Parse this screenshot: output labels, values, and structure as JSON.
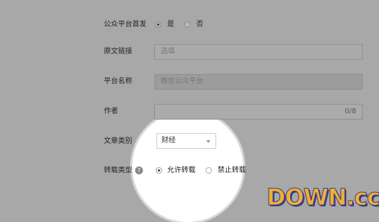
{
  "form": {
    "publish_first": {
      "label": "公众平台首发",
      "options": [
        "是",
        "否"
      ],
      "selected": "是"
    },
    "original_link": {
      "label": "原文链接",
      "placeholder": "选填"
    },
    "platform_name": {
      "label": "平台名称",
      "value": "微信公众平台"
    },
    "author": {
      "label": "作者",
      "counter": "0/8"
    },
    "category": {
      "label": "文章类别",
      "value": "财经"
    },
    "repost_type": {
      "label": "转载类型",
      "options": [
        "允许转载",
        "禁止转载"
      ],
      "selected": "允许转载"
    }
  },
  "watermark": {
    "text": "DOWN.cc"
  },
  "icons": [
    "radio-icon",
    "help-icon",
    "chevron-down-icon"
  ]
}
